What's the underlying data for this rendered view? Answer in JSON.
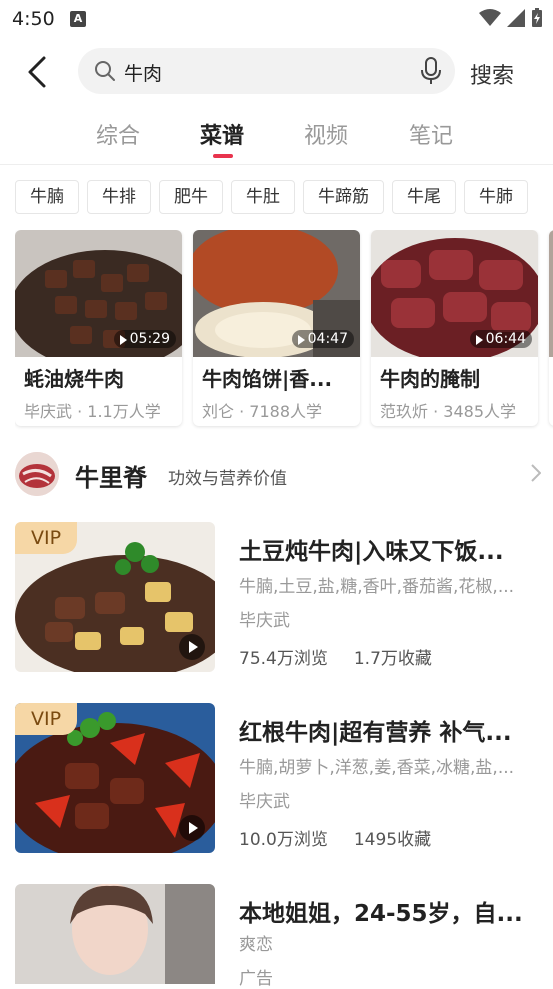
{
  "status_bar": {
    "time": "4:50",
    "notif_icon": "A"
  },
  "search": {
    "query": "牛肉",
    "button_label": "搜索"
  },
  "tabs": [
    {
      "label": "综合",
      "active": false
    },
    {
      "label": "菜谱",
      "active": true
    },
    {
      "label": "视频",
      "active": false
    },
    {
      "label": "笔记",
      "active": false
    }
  ],
  "chips": [
    "牛腩",
    "牛排",
    "肥牛",
    "牛肚",
    "牛蹄筋",
    "牛尾",
    "牛肺"
  ],
  "video_cards": [
    {
      "duration": "05:29",
      "title": "蚝油烧牛肉",
      "author": "毕庆武",
      "learners": "1.1万人学"
    },
    {
      "duration": "04:47",
      "title": "牛肉馅饼|香...",
      "author": "刘仑",
      "learners": "7188人学"
    },
    {
      "duration": "06:44",
      "title": "牛肉的腌制",
      "author": "范玖炘",
      "learners": "3485人学"
    }
  ],
  "ingredient": {
    "name": "牛里脊",
    "subtitle": "功效与营养价值"
  },
  "recipes": [
    {
      "vip": "VIP",
      "title": "土豆炖牛肉|入味又下饭...",
      "ingredients": "牛腩,土豆,盐,糖,香叶,番茄酱,花椒,...",
      "author": "毕庆武",
      "views": "75.4万浏览",
      "favorites": "1.7万收藏"
    },
    {
      "vip": "VIP",
      "title": "红根牛肉|超有营养 补气...",
      "ingredients": "牛腩,胡萝卜,洋葱,姜,香菜,冰糖,盐,...",
      "author": "毕庆武",
      "views": "10.0万浏览",
      "favorites": "1495收藏"
    }
  ],
  "ad": {
    "title": "本地姐姐，24-55岁，自...",
    "source": "爽恋",
    "label": "广告"
  }
}
